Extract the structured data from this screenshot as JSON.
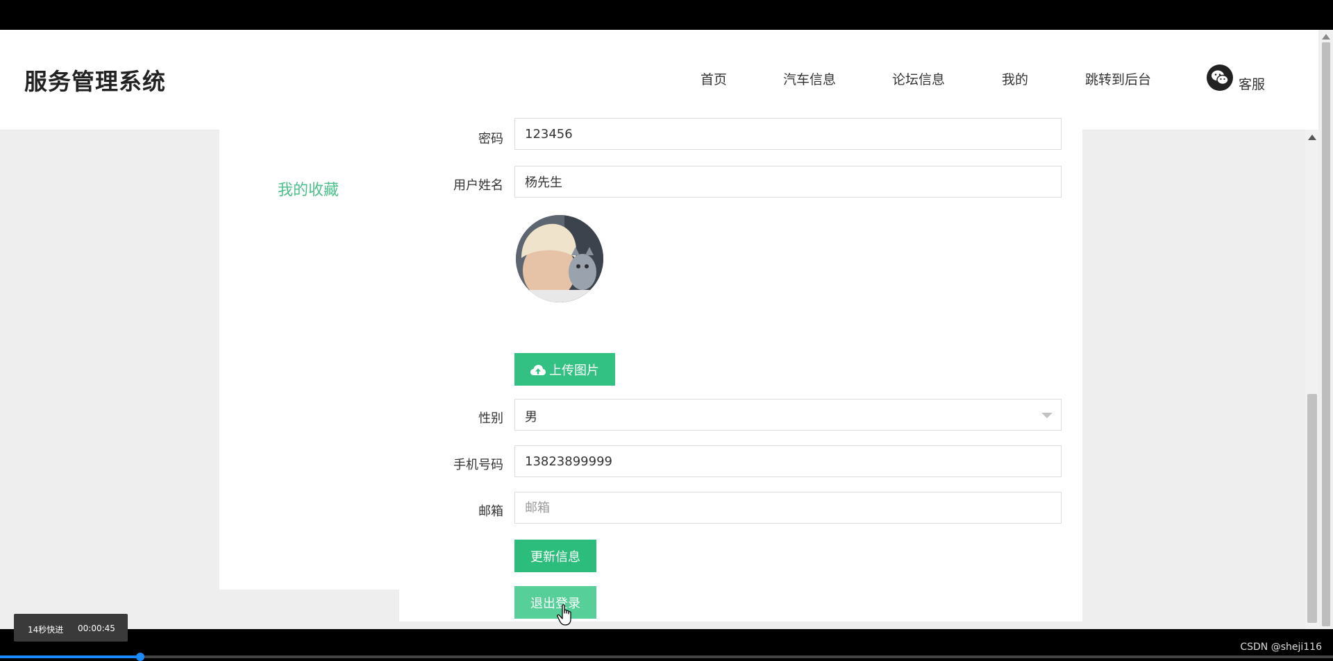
{
  "header": {
    "logo": "服务管理系统",
    "nav": [
      {
        "label": "首页"
      },
      {
        "label": "汽车信息"
      },
      {
        "label": "论坛信息"
      },
      {
        "label": "我的"
      },
      {
        "label": "跳转到后台"
      }
    ],
    "customer_service": "客服"
  },
  "side_menu": {
    "items": [
      {
        "label": "我的收藏"
      }
    ]
  },
  "form": {
    "password": {
      "label": "密码",
      "value": "123456"
    },
    "name": {
      "label": "用户姓名",
      "value": "杨先生"
    },
    "upload_button": "上传图片",
    "gender": {
      "label": "性别",
      "value": "男"
    },
    "phone": {
      "label": "手机号码",
      "value": "13823899999"
    },
    "email": {
      "label": "邮箱",
      "value": "",
      "placeholder": "邮箱"
    },
    "update_button": "更新信息",
    "logout_button": "退出登录"
  },
  "video_overlay": {
    "speed_label": "14秒快进",
    "time": "00:00:45",
    "progress": 0.105
  },
  "watermark": "CSDN @sheji116",
  "colors": {
    "accent": "#33c183",
    "menu_active": "#4cc08b"
  }
}
